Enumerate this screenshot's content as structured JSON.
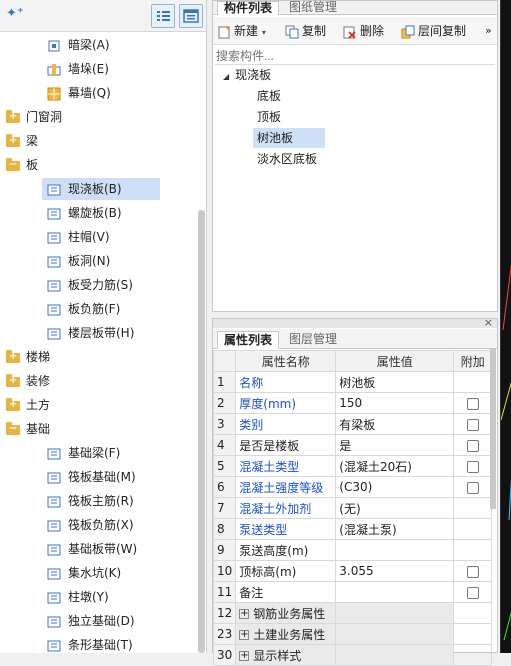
{
  "left_tree": {
    "items": [
      {
        "type": "leaf",
        "label": "暗梁(A)",
        "icon": "dark-beam-icon"
      },
      {
        "type": "leaf",
        "label": "墙垛(E)",
        "icon": "wall-pier-icon"
      },
      {
        "type": "leaf",
        "label": "幕墙(Q)",
        "icon": "curtain-wall-icon"
      },
      {
        "type": "folder",
        "label": "门窗洞",
        "state": "+"
      },
      {
        "type": "folder",
        "label": "梁",
        "state": "+"
      },
      {
        "type": "folder",
        "label": "板",
        "state": "-"
      },
      {
        "type": "leaf",
        "label": "现浇板(B)",
        "icon": "cast-slab-icon",
        "selected": true
      },
      {
        "type": "leaf",
        "label": "螺旋板(B)",
        "icon": "spiral-slab-icon"
      },
      {
        "type": "leaf",
        "label": "柱帽(V)",
        "icon": "column-cap-icon"
      },
      {
        "type": "leaf",
        "label": "板洞(N)",
        "icon": "slab-hole-icon"
      },
      {
        "type": "leaf",
        "label": "板受力筋(S)",
        "icon": "slab-main-rebar-icon"
      },
      {
        "type": "leaf",
        "label": "板负筋(F)",
        "icon": "slab-negative-rebar-icon"
      },
      {
        "type": "leaf",
        "label": "楼层板带(H)",
        "icon": "floor-slab-strip-icon"
      },
      {
        "type": "folder",
        "label": "楼梯",
        "state": "+"
      },
      {
        "type": "folder",
        "label": "装修",
        "state": "+"
      },
      {
        "type": "folder",
        "label": "土方",
        "state": "+"
      },
      {
        "type": "folder",
        "label": "基础",
        "state": "-"
      },
      {
        "type": "leaf",
        "label": "基础梁(F)",
        "icon": "foundation-beam-icon"
      },
      {
        "type": "leaf",
        "label": "筏板基础(M)",
        "icon": "raft-foundation-icon"
      },
      {
        "type": "leaf",
        "label": "筏板主筋(R)",
        "icon": "raft-main-rebar-icon"
      },
      {
        "type": "leaf",
        "label": "筏板负筋(X)",
        "icon": "raft-negative-rebar-icon"
      },
      {
        "type": "leaf",
        "label": "基础板带(W)",
        "icon": "foundation-strip-icon"
      },
      {
        "type": "leaf",
        "label": "集水坑(K)",
        "icon": "sump-pit-icon"
      },
      {
        "type": "leaf",
        "label": "柱墩(Y)",
        "icon": "column-pier-icon"
      },
      {
        "type": "leaf",
        "label": "独立基础(D)",
        "icon": "isolated-foundation-icon"
      },
      {
        "type": "leaf",
        "label": "条形基础(T)",
        "icon": "strip-foundation-icon"
      }
    ]
  },
  "component_panel": {
    "tabs": [
      "构件列表",
      "图纸管理"
    ],
    "toolbar": {
      "new": "新建",
      "copy": "复制",
      "delete": "删除",
      "floor_copy": "层间复制",
      "more": "»"
    },
    "search_placeholder": "搜索构件...",
    "root": "现浇板",
    "items": [
      "底板",
      "顶板",
      "树池板",
      "淡水区底板"
    ],
    "selected": "树池板"
  },
  "property_panel": {
    "tabs": [
      "属性列表",
      "图层管理"
    ],
    "headers": [
      "属性名称",
      "属性值",
      "附加"
    ],
    "rows": [
      {
        "n": "1",
        "name": "名称",
        "value": "树池板",
        "blue": true,
        "check": false
      },
      {
        "n": "2",
        "name": "厚度(mm)",
        "value": "150",
        "blue": true,
        "check": true
      },
      {
        "n": "3",
        "name": "类别",
        "value": "有梁板",
        "blue": true,
        "check": true
      },
      {
        "n": "4",
        "name": "是否是楼板",
        "value": "是",
        "blue": false,
        "check": true
      },
      {
        "n": "5",
        "name": "混凝土类型",
        "value": "(混凝土20石)",
        "blue": true,
        "check": true
      },
      {
        "n": "6",
        "name": "混凝土强度等级",
        "value": "(C30)",
        "blue": true,
        "check": true
      },
      {
        "n": "7",
        "name": "混凝土外加剂",
        "value": "(无)",
        "blue": true,
        "check": false
      },
      {
        "n": "8",
        "name": "泵送类型",
        "value": "(混凝土泵)",
        "blue": true,
        "check": false
      },
      {
        "n": "9",
        "name": "泵送高度(m)",
        "value": "",
        "blue": false,
        "check": false
      },
      {
        "n": "10",
        "name": "顶标高(m)",
        "value": "3.055",
        "blue": false,
        "check": true
      },
      {
        "n": "11",
        "name": "备注",
        "value": "",
        "blue": false,
        "check": true
      },
      {
        "n": "12",
        "name": "钢筋业务属性",
        "value": "",
        "blue": false,
        "group": true
      },
      {
        "n": "23",
        "name": "土建业务属性",
        "value": "",
        "blue": false,
        "group": true
      },
      {
        "n": "30",
        "name": "显示样式",
        "value": "",
        "blue": false,
        "group": true
      }
    ]
  },
  "colors": {
    "selected": "#cde0f7",
    "link_blue": "#1a4fd6",
    "folder": "#e9b341"
  }
}
